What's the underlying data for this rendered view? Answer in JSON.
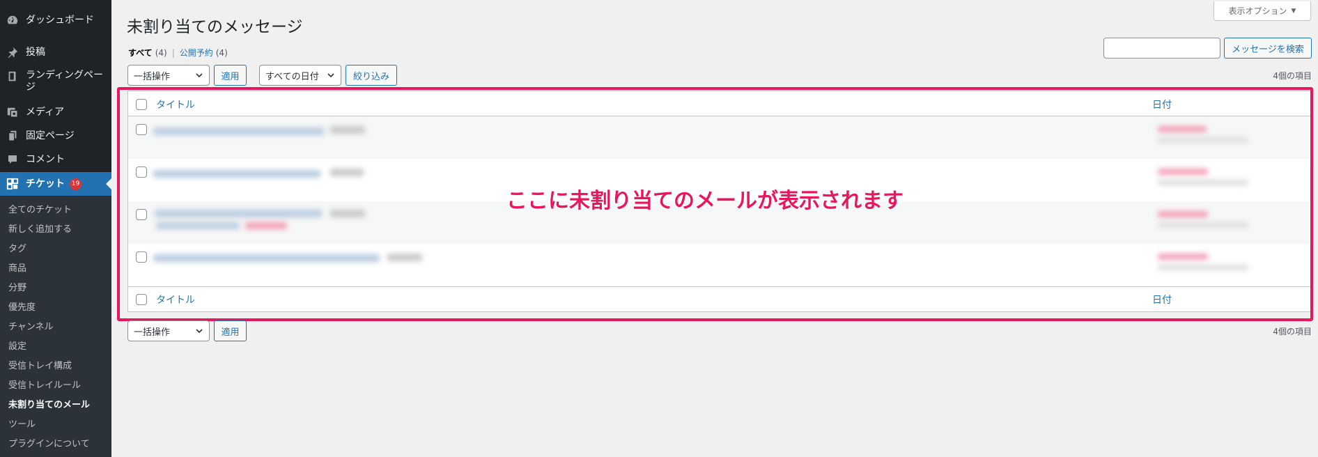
{
  "sidebar": {
    "menu": [
      {
        "label": "ダッシュボード",
        "icon": "dashboard-icon"
      },
      {
        "label": "投稿",
        "icon": "pin-icon"
      },
      {
        "label": "ランディングページ",
        "icon": "book-icon"
      },
      {
        "label": "メディア",
        "icon": "media-icon"
      },
      {
        "label": "固定ページ",
        "icon": "pages-icon"
      },
      {
        "label": "コメント",
        "icon": "comment-icon"
      },
      {
        "label": "チケット",
        "icon": "ticket-icon",
        "badge": "19"
      }
    ],
    "submenu": [
      "全てのチケット",
      "新しく追加する",
      "タグ",
      "商品",
      "分野",
      "優先度",
      "チャンネル",
      "設定",
      "受信トレイ構成",
      "受信トレイルール",
      "未割り当てのメール",
      "ツール",
      "プラグインについて"
    ],
    "active_submenu": "未割り当てのメール"
  },
  "header": {
    "title": "未割り当てのメッセージ",
    "screen_options": "表示オプション"
  },
  "views": {
    "all_label": "すべて",
    "all_count": "(4)",
    "scheduled_label": "公開予約",
    "scheduled_count": "(4)"
  },
  "search": {
    "placeholder": "",
    "button": "メッセージを検索"
  },
  "toolbar": {
    "bulk_action": "一括操作",
    "apply": "適用",
    "date_filter": "すべての日付",
    "filter_button": "絞り込み",
    "items_count": "4個の項目"
  },
  "table": {
    "col_title": "タイトル",
    "col_date": "日付",
    "row_count": 4
  },
  "annotation": "ここに未割り当てのメールが表示されます",
  "colors": {
    "sidebar_bg": "#1d2327",
    "submenu_bg": "#2c3338",
    "accent": "#2271b1",
    "highlight": "#e8175d",
    "badge": "#d63638"
  }
}
